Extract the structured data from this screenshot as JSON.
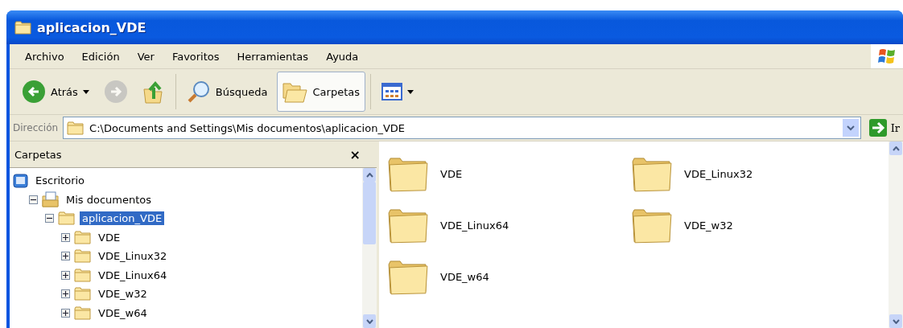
{
  "window": {
    "title": "aplicacion_VDE"
  },
  "menu": [
    "Archivo",
    "Edición",
    "Ver",
    "Favoritos",
    "Herramientas",
    "Ayuda"
  ],
  "toolbar": [
    {
      "kind": "back",
      "label": "Atrás",
      "disabled": false,
      "selected": false
    },
    {
      "kind": "forward",
      "disabled": true,
      "selected": false
    },
    {
      "kind": "up",
      "disabled": false,
      "selected": false
    },
    {
      "kind": "search",
      "label": "Búsqueda",
      "disabled": false,
      "selected": false
    },
    {
      "kind": "folders",
      "label": "Carpetas",
      "disabled": false,
      "selected": true
    },
    {
      "kind": "views",
      "disabled": false,
      "selected": false
    }
  ],
  "address": {
    "label": "Dirección",
    "value": "C:\\Documents and Settings\\Mis documentos\\aplicacion_VDE",
    "go": "Ir"
  },
  "folders_pane": {
    "title": "Carpetas",
    "close": "×",
    "tree": [
      {
        "name": "Escritorio",
        "kind": "desktop",
        "selected": false,
        "children": [
          {
            "name": "Mis documentos",
            "kind": "documents",
            "expanded": true,
            "selected": false,
            "children": [
              {
                "name": "aplicacion_VDE",
                "kind": "folder",
                "expanded": true,
                "selected": true,
                "children": [
                  {
                    "name": "VDE",
                    "kind": "folder",
                    "expanded": false,
                    "selected": false
                  },
                  {
                    "name": "VDE_Linux32",
                    "kind": "folder",
                    "expanded": false,
                    "selected": false
                  },
                  {
                    "name": "VDE_Linux64",
                    "kind": "folder",
                    "expanded": false,
                    "selected": false
                  },
                  {
                    "name": "VDE_w32",
                    "kind": "folder",
                    "expanded": false,
                    "selected": false
                  },
                  {
                    "name": "VDE_w64",
                    "kind": "folder",
                    "expanded": false,
                    "selected": false
                  }
                ]
              }
            ]
          }
        ]
      }
    ]
  },
  "files": [
    {
      "name": "VDE"
    },
    {
      "name": "VDE_Linux32"
    },
    {
      "name": "VDE_Linux64"
    },
    {
      "name": "VDE_w32"
    },
    {
      "name": "VDE_w64"
    }
  ]
}
